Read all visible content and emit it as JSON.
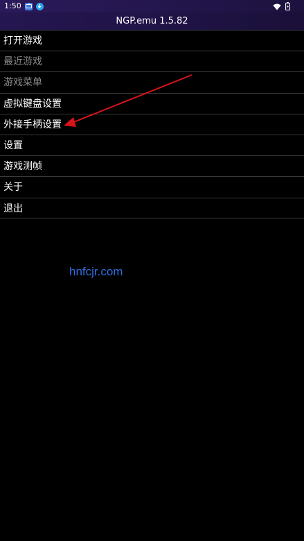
{
  "status_bar": {
    "time": "1:50",
    "icons": [
      "tv-app-icon",
      "download-icon",
      "wifi-icon",
      "battery-icon"
    ]
  },
  "title_bar": {
    "title": "NGP.emu 1.5.82"
  },
  "menu": {
    "items": [
      {
        "label": "打开游戏",
        "enabled": true
      },
      {
        "label": "最近游戏",
        "enabled": false
      },
      {
        "label": "游戏菜单",
        "enabled": false
      },
      {
        "label": "虚拟键盘设置",
        "enabled": true
      },
      {
        "label": "外接手柄设置",
        "enabled": true
      },
      {
        "label": "设置",
        "enabled": true
      },
      {
        "label": "游戏测帧",
        "enabled": true
      },
      {
        "label": "关于",
        "enabled": true
      },
      {
        "label": "退出",
        "enabled": true
      }
    ]
  },
  "watermark": {
    "text": "hnfcjr.com",
    "color": "#2f6fe0"
  },
  "annotation": {
    "arrow_color": "#d8141a",
    "target": "外接手柄设置"
  },
  "colors": {
    "background": "#000000",
    "title_bar": "#211448",
    "divider": "#3a3a3a",
    "disabled_text": "#8c8c8c"
  }
}
